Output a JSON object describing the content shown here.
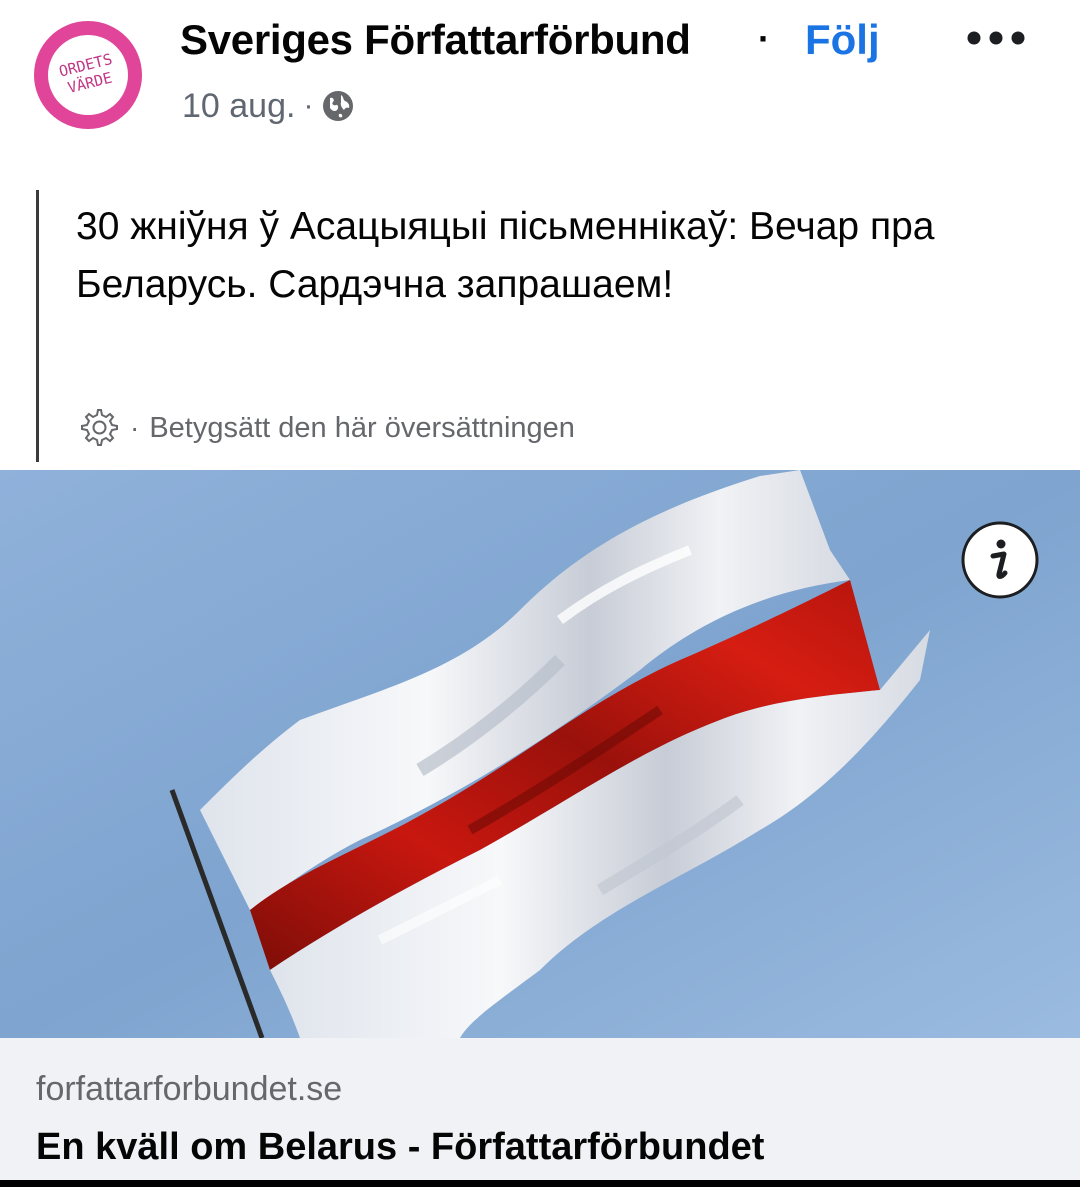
{
  "header": {
    "page_name": "Sveriges Författarförbund",
    "separator": "·",
    "follow_label": "Följ",
    "timestamp": "10 aug.",
    "meta_separator": "·",
    "privacy_icon": "globe-icon",
    "more_icon": "ellipsis-icon",
    "avatar": {
      "line1": "ORDETS",
      "line2": "VÄRDE",
      "ring_color": "#e0459a"
    }
  },
  "post": {
    "text": "30 жніўня ў Асацыяцыі пісьменнікаў: Вечар пра Беларусь. Сардэчна запрашаем!",
    "rate_icon": "gear-icon",
    "rate_separator": "·",
    "rate_label": "Betygsätt den här översättningen"
  },
  "image": {
    "subject": "white-red-white flag",
    "info_icon": "info-icon"
  },
  "link_preview": {
    "domain": "forfattarforbundet.se",
    "title": "En kväll om Belarus - Författarförbundet"
  },
  "colors": {
    "accent": "#1b74e4",
    "secondary_text": "#65676b",
    "link_bg": "#f0f2f5",
    "flag_red": "#c8170f",
    "sky": "#7ea4cf"
  }
}
